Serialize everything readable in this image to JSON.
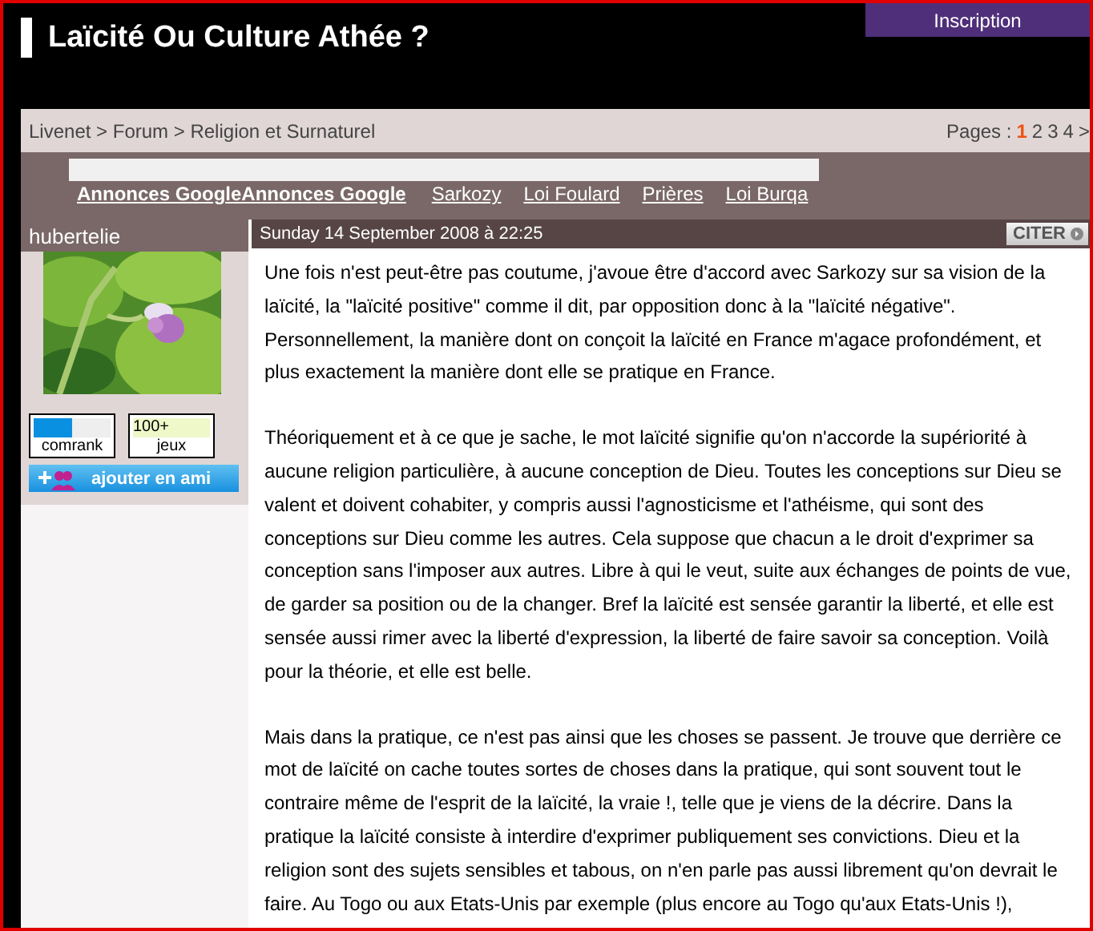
{
  "header": {
    "title": "Laïcité Ou Culture Athée ?",
    "signup": "Inscription"
  },
  "breadcrumb": {
    "path": "Livenet > Forum > Religion et Surnaturel",
    "pages_label": "Pages :",
    "pages": [
      {
        "label": "1",
        "selected": true
      },
      {
        "label": "2",
        "selected": false
      },
      {
        "label": "3",
        "selected": false
      },
      {
        "label": "4",
        "selected": false
      }
    ],
    "next": ">"
  },
  "ads": {
    "label": "Annonces GoogleAnnonces Google",
    "links": [
      "Sarkozy",
      "Loi Foulard",
      "Prières",
      "Loi Burqa"
    ]
  },
  "author": {
    "name": "hubertelie",
    "comrank": {
      "label": "comrank",
      "level": 0.5
    },
    "games": {
      "value": "100+",
      "label": "jeux"
    },
    "add_friend": "ajouter en ami"
  },
  "post": {
    "date": "Sunday 14 September 2008 à 22:25",
    "quote": "CITER",
    "paragraphs": [
      "Une fois n'est peut-être pas coutume, j'avoue être d'accord avec Sarkozy sur sa vision de la laïcité, la \"laïcité positive\" comme il dit, par opposition donc à la \"laïcité négative\". Personnellement, la manière dont on conçoit la laïcité en France m'agace profondément, et plus exactement la manière dont elle se pratique en France.",
      "Théoriquement et à ce que je sache, le mot laïcité signifie qu'on n'accorde la supériorité à aucune religion particulière, à aucune conception de Dieu. Toutes les conceptions sur Dieu se valent et doivent cohabiter, y compris aussi l'agnosticisme et l'athéisme, qui sont des conceptions sur Dieu comme les autres. Cela suppose que chacun a le droit d'exprimer sa conception sans l'imposer aux autres. Libre à qui le veut, suite aux échanges de points de vue, de garder sa position ou de la changer. Bref la laïcité est sensée garantir la liberté, et elle est sensée aussi rimer avec la liberté d'expression, la liberté de faire savoir sa conception. Voilà pour la théorie, et elle est belle.",
      "Mais dans la pratique, ce n'est pas ainsi que les choses se passent. Je trouve que derrière ce mot de laïcité on cache toutes sortes de choses dans la pratique, qui sont souvent tout le contraire même de l'esprit de la laïcité, la vraie !, telle que je viens de la décrire. Dans la pratique la laïcité consiste à interdire d'exprimer publiquement ses convictions. Dieu et la religion sont des sujets sensibles et tabous, on n'en parle pas aussi librement qu'on devrait le faire. Au Togo ou aux Etats-Unis par exemple (plus encore au Togo qu'aux Etats-Unis !),"
    ]
  }
}
